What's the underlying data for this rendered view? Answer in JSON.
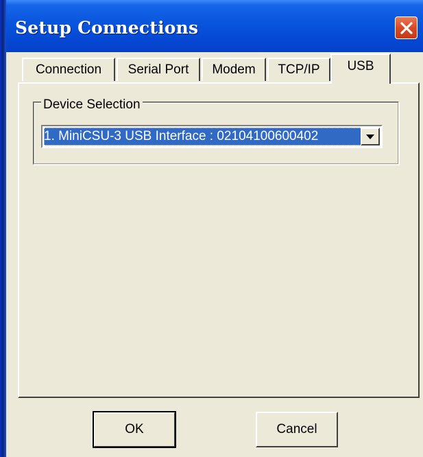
{
  "window": {
    "title": "Setup Connections"
  },
  "tabs": [
    {
      "label": "Connection",
      "active": false
    },
    {
      "label": "Serial Port",
      "active": false
    },
    {
      "label": "Modem",
      "active": false
    },
    {
      "label": "TCP/IP",
      "active": false
    },
    {
      "label": "USB",
      "active": true
    }
  ],
  "usb": {
    "group_label": "Device Selection",
    "device_value": "1. MiniCSU-3 USB Interface : 02104100600402"
  },
  "buttons": {
    "ok_label": "OK",
    "cancel_label": "Cancel"
  },
  "colors": {
    "titlebar": "#0855dd",
    "selection": "#316ac5",
    "face": "#ece9d8",
    "close": "#d84a26"
  },
  "icons": [
    "close-icon",
    "dropdown-arrow-icon"
  ]
}
